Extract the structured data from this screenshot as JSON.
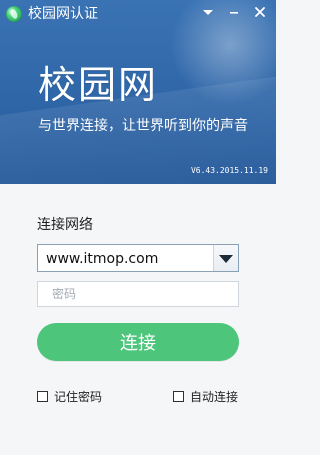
{
  "window": {
    "title": "校园网认证",
    "controls": {
      "dropdown_icon": "chevron-down-icon",
      "minimize_icon": "minimize-icon",
      "close_icon": "close-icon"
    }
  },
  "hero": {
    "title": "校园网",
    "slogan": "与世界连接，让世界听到你的声音",
    "version": "V6.43.2015.11.19"
  },
  "form": {
    "network_label": "连接网络",
    "network_selected": "www.itmop.com",
    "password_placeholder": "密码",
    "password_value": "",
    "connect_label": "连接",
    "remember_label": "记住密码",
    "remember_checked": false,
    "auto_label": "自动连接",
    "auto_checked": false
  },
  "colors": {
    "header_blue": "#2f66a8",
    "button_green": "#4dc57b",
    "background": "#f4f6f8"
  }
}
